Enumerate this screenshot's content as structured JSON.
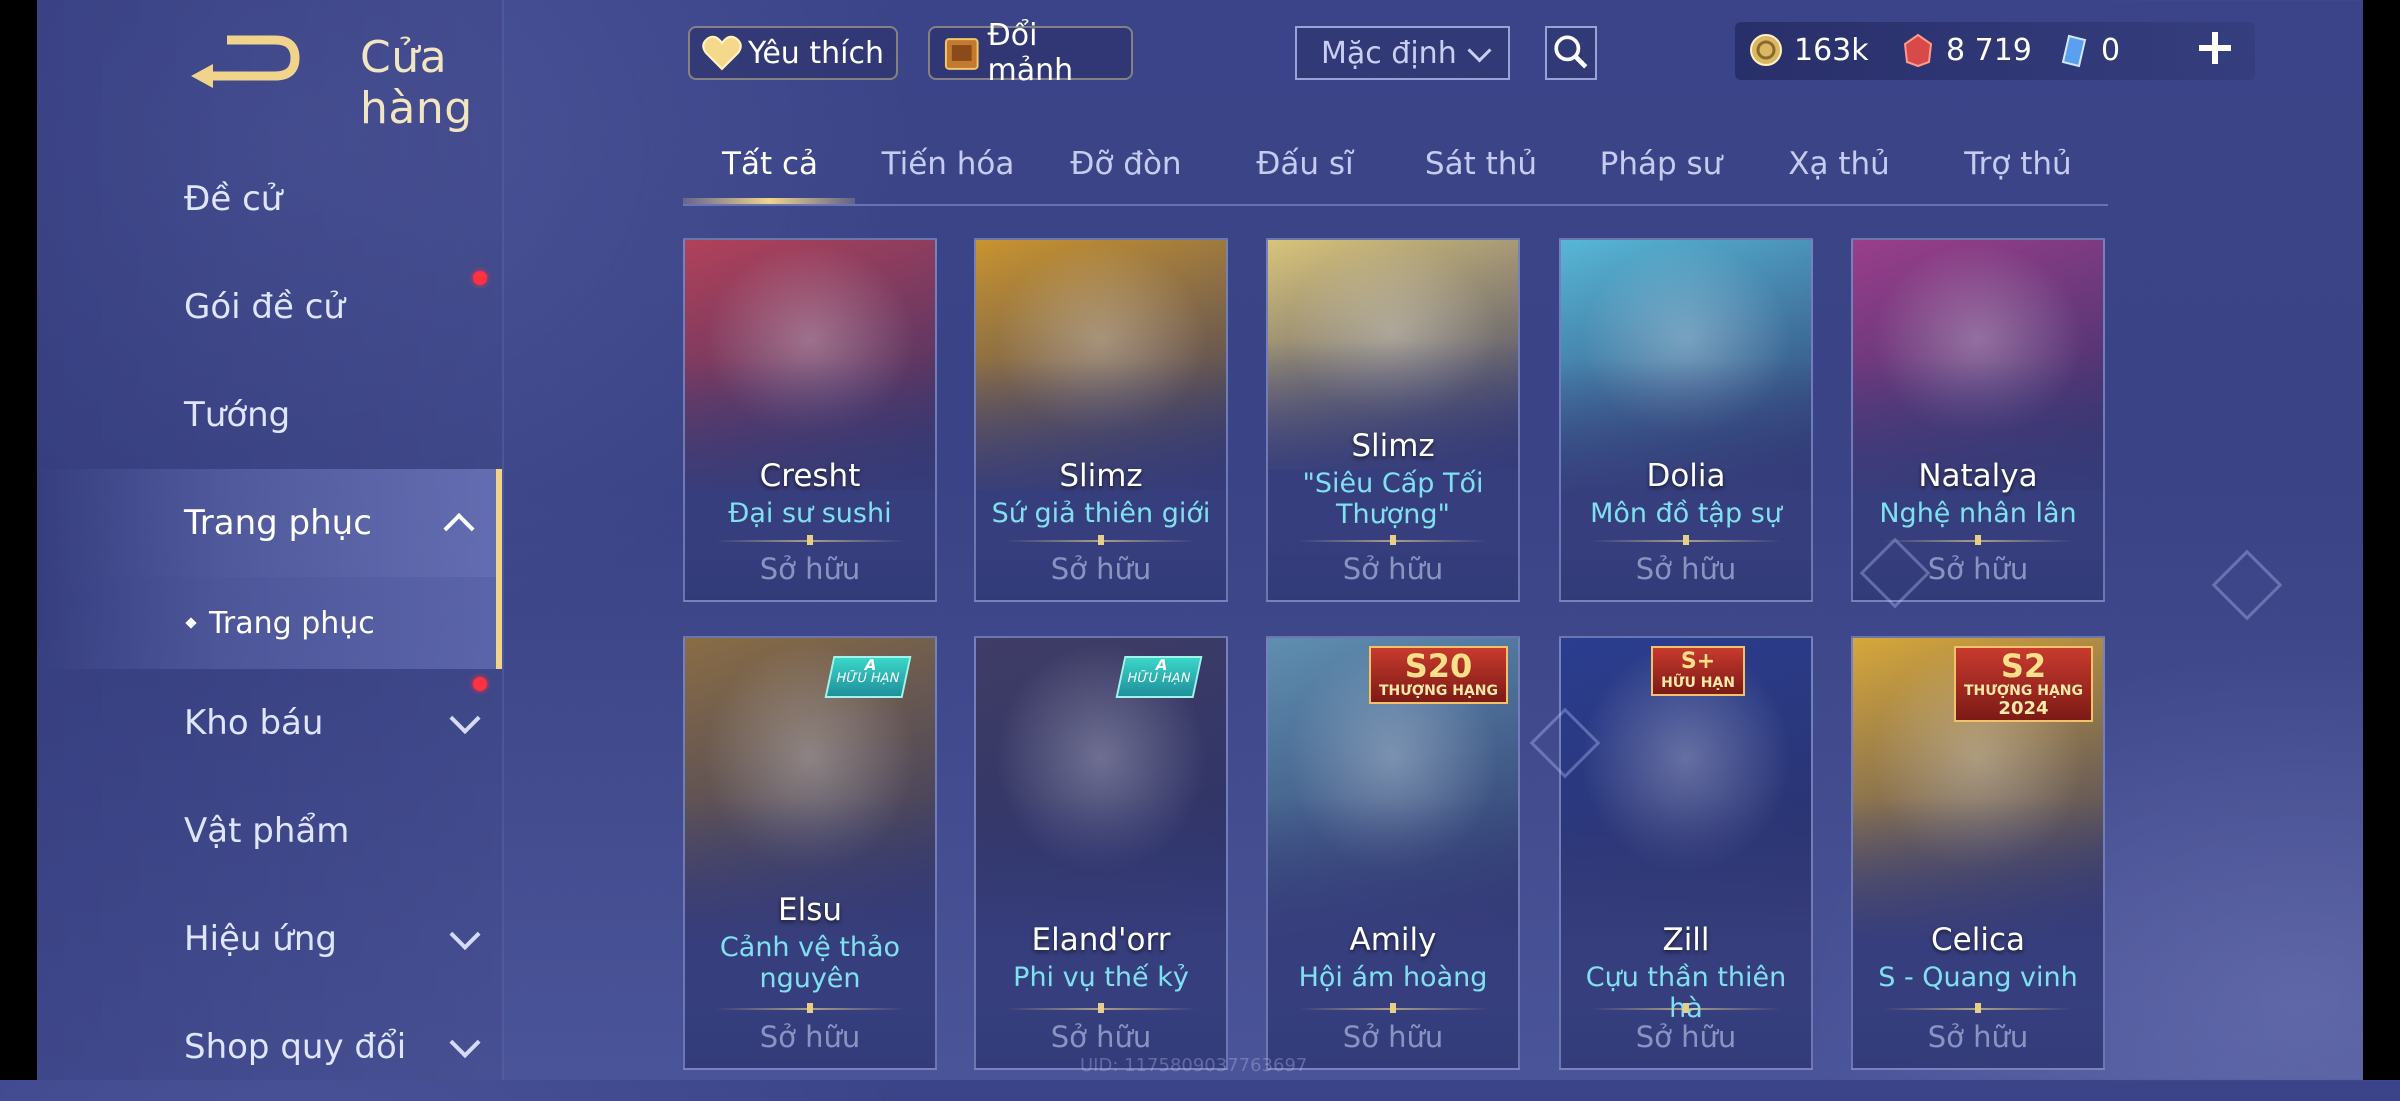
{
  "header": {
    "title": "Cửa hàng",
    "favorites_label": "Yêu thích",
    "exchange_label": "Đổi mảnh",
    "sort_selected": "Mặc định"
  },
  "currency": [
    {
      "icon": "gold-coin-icon",
      "value": "163k"
    },
    {
      "icon": "red-voucher-icon",
      "value": "8 719"
    },
    {
      "icon": "blue-ticket-icon",
      "value": "0"
    }
  ],
  "sidebar": {
    "items": [
      {
        "label": "Đề cử"
      },
      {
        "label": "Gói đề cử"
      },
      {
        "label": "Tướng"
      },
      {
        "label": "Trang phục"
      },
      {
        "label": "Trang phục"
      },
      {
        "label": "Kho báu"
      },
      {
        "label": "Vật phẩm"
      },
      {
        "label": "Hiệu ứng"
      },
      {
        "label": "Shop quy đổi"
      }
    ]
  },
  "tabs": [
    "Tất cả",
    "Tiến hóa",
    "Đỡ đòn",
    "Đấu sĩ",
    "Sát thủ",
    "Pháp sư",
    "Xạ thủ",
    "Trợ thủ"
  ],
  "cards": [
    {
      "hero": "Cresht",
      "skin": "Đại sư sushi",
      "status": "Sở hữu",
      "accent": "#b2415a"
    },
    {
      "hero": "Slimz",
      "skin": "Sứ giả thiên giới",
      "status": "Sở hữu",
      "accent": "#c9942f"
    },
    {
      "hero": "Slimz",
      "skin": "\"Siêu Cấp Tối Thượng\"",
      "status": "Sở hữu",
      "accent": "#d9c47a"
    },
    {
      "hero": "Dolia",
      "skin": "Môn đồ tập sự",
      "status": "Sở hữu",
      "accent": "#57b7d6"
    },
    {
      "hero": "Natalya",
      "skin": "Nghệ nhân lân",
      "status": "Sở hữu",
      "accent": "#9a3e8a"
    },
    {
      "hero": "Elsu",
      "skin": "Cảnh vệ thảo nguyên",
      "status": "Sở hữu",
      "accent": "#8a6d45",
      "badge_top": "A",
      "badge_bottom": "HỮU HẠN"
    },
    {
      "hero": "Eland'orr",
      "skin": "Phi vụ thế kỷ",
      "status": "Sở hữu",
      "accent": "#3f3d66",
      "badge_top": "A",
      "badge_bottom": "HỮU HẠN"
    },
    {
      "hero": "Amily",
      "skin": "Hội ám hoàng",
      "status": "Sở hữu",
      "accent": "#5f8fb0",
      "badge_top": "S20",
      "badge_bottom": "THƯỢNG HẠNG"
    },
    {
      "hero": "Zill",
      "skin": "Cựu thần thiên hà",
      "status": "Sở hữu",
      "accent": "#2a3d8f",
      "badge_top": "S+",
      "badge_bottom": "HỮU HẠN"
    },
    {
      "hero": "Celica",
      "skin": "S - Quang vinh",
      "status": "Sở hữu",
      "accent": "#d7a73a",
      "badge_top": "S2",
      "badge_mid": "THƯỢNG HẠNG",
      "badge_bottom": "2024"
    }
  ],
  "uid": "UID: 1175809037763697"
}
